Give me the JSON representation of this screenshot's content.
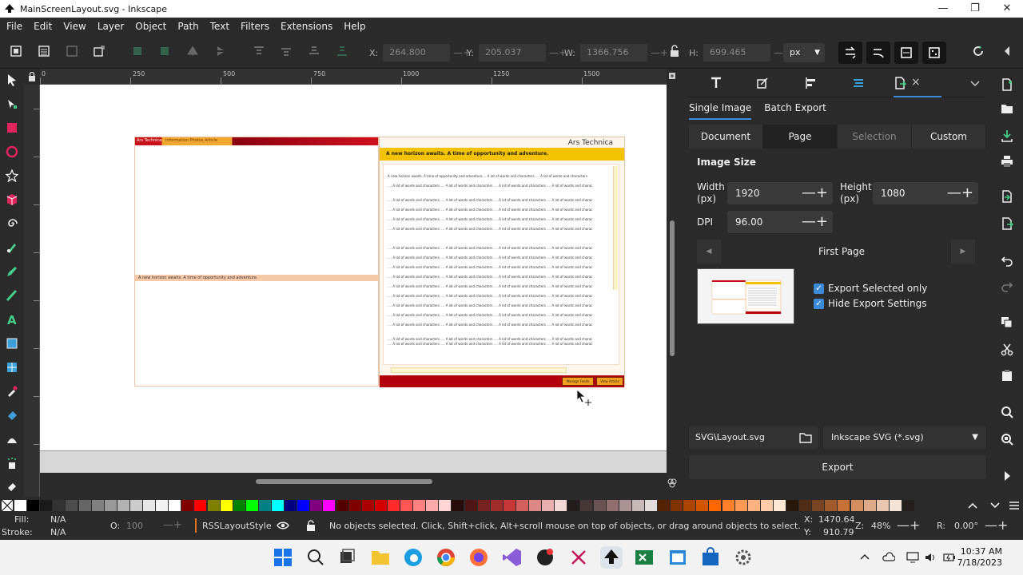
{
  "window": {
    "title": "MainScreenLayout.svg - Inkscape",
    "minimize": "—",
    "maximize": "❐",
    "close": "✕"
  },
  "menu": [
    "File",
    "Edit",
    "View",
    "Layer",
    "Object",
    "Path",
    "Text",
    "Filters",
    "Extensions",
    "Help"
  ],
  "toolbar": {
    "x_label": "X:",
    "x_value": "264.800",
    "y_label": "Y:",
    "y_value": "205.037",
    "w_label": "W:",
    "w_value": "1366.756",
    "h_label": "H:",
    "h_value": "699.465",
    "unit": "px",
    "pm": "—+"
  },
  "ruler": {
    "marks": [
      "0",
      "250",
      "500",
      "750",
      "1000",
      "1250",
      "1500"
    ]
  },
  "drawing": {
    "left_header_brand": "Ars Technica",
    "left_header_tabs": "Information   Photos   Article",
    "left_mid": "A new horizon awaits. A time of opportunity and adventure.",
    "right_brand": "Ars Technica",
    "right_banner": "A new horizon awaits. A time of opportunity and adventure.",
    "first_line": "A new horizon awaits. A time of opportunity and adventure.... A lot of words and characters .... A lot of words and characters",
    "body_line": ".... A lot of words and characters .... A lot of words and characters .... A lot of words and characters .... A lot of words and charac",
    "btn_manage": "Manage Feeds",
    "btn_view": "View Article"
  },
  "dock": {
    "close_tab": "×",
    "subtabs": [
      "Single Image",
      "Batch Export"
    ],
    "segments": [
      "Document",
      "Page",
      "Selection",
      "Custom"
    ],
    "section": "Image Size",
    "width_label": "Width\n(px)",
    "width_value": "1920",
    "height_label": "Height\n(px)",
    "height_value": "1080",
    "dpi_label": "DPI",
    "dpi_value": "96.00",
    "pm": "—+",
    "page_label": "First Page",
    "check_selected": "Export Selected only",
    "check_hide": "Hide Export Settings",
    "filename": "SVG\\Layout.svg",
    "filetype": "Inkscape SVG (*.svg)",
    "export_button": "Export"
  },
  "status": {
    "fill_label": "Fill:",
    "fill_value": "N/A",
    "stroke_label": "Stroke:",
    "stroke_value": "N/A",
    "opacity_label": "O:",
    "opacity_value": "100",
    "layer": "RSSLayoutStyle",
    "message": "No objects selected. Click, Shift+click, Alt+scroll mouse on top of objects, or drag around objects to select.",
    "x_label": "X:",
    "x_value": "1470.64",
    "y_label": "Y:",
    "y_value": "910.79",
    "zoom_label": "Z:",
    "zoom_value": "48%",
    "rot_label": "R:",
    "rot_value": "0.00°"
  },
  "taskbar": {
    "time": "10:37 AM",
    "date": "7/18/2023"
  },
  "palette": [
    "#ffffff",
    "#000000",
    "#1a1a1a",
    "#333333",
    "#4d4d4d",
    "#666666",
    "#808080",
    "#999999",
    "#b3b3b3",
    "#cccccc",
    "#e6e6e6",
    "#f2f2f2",
    "#ffffff",
    "#800000",
    "#ff0000",
    "#808000",
    "#ffff00",
    "#008000",
    "#00ff00",
    "#008080",
    "#00ffff",
    "#000080",
    "#0000ff",
    "#800080",
    "#ff00ff",
    "#550000",
    "#800000",
    "#aa0000",
    "#d40000",
    "#ff2a2a",
    "#ff5555",
    "#ff8080",
    "#ffaaaa",
    "#ffd5d5",
    "#280b0b",
    "#501616",
    "#782121",
    "#a02c2c",
    "#c83737",
    "#d35f5f",
    "#de8787",
    "#e9afaf",
    "#f4d7d7",
    "#241c1c",
    "#483737",
    "#6c5353",
    "#916f6f",
    "#ac9393",
    "#c8b7b7",
    "#e3dbdb",
    "#552200",
    "#803300",
    "#aa4400",
    "#d45500",
    "#ff6600",
    "#ff7f2a",
    "#ff9955",
    "#ffb380",
    "#ffccaa",
    "#ffe6d5",
    "#28170b",
    "#502d16",
    "#784421",
    "#a05a2c",
    "#c87137",
    "#d38d5f",
    "#deaa87",
    "#e9c6af",
    "#f4e3d7",
    "#241f1c"
  ]
}
